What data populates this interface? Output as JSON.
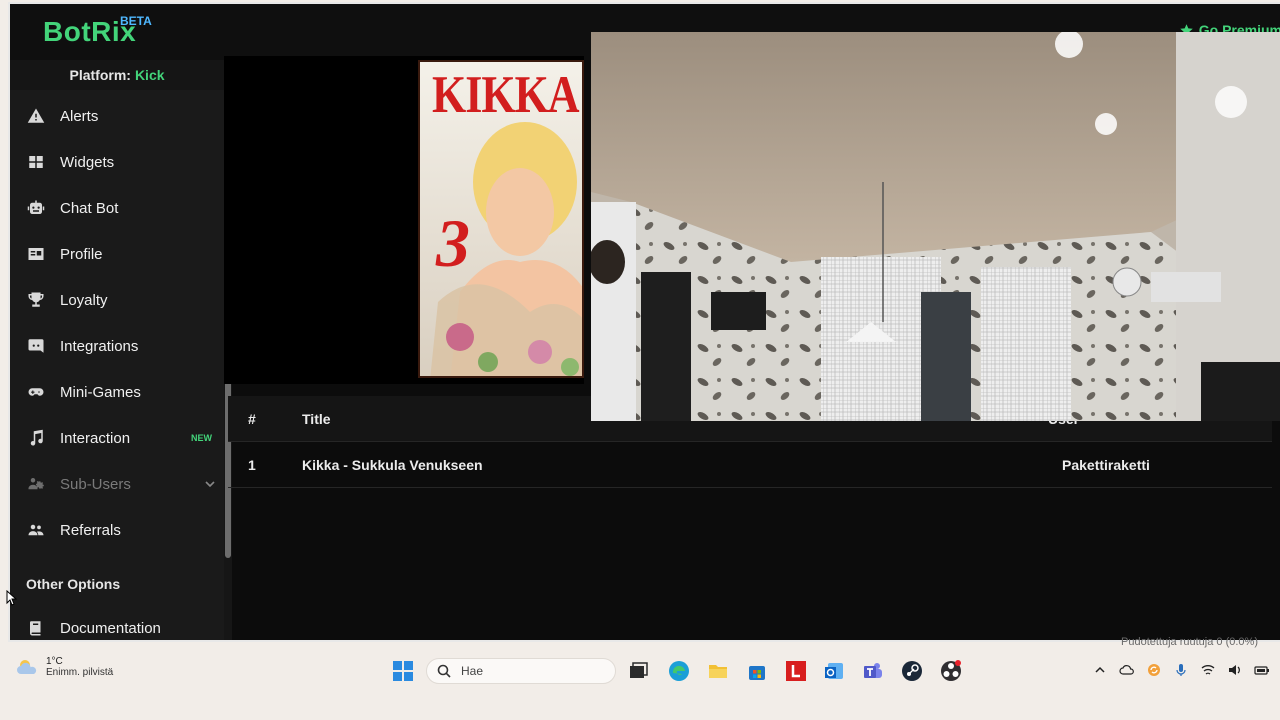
{
  "app": {
    "logo": "BotRix",
    "logo_badge": "BETA",
    "go_premium": "Go Premium"
  },
  "sidebar": {
    "platform_label": "Platform:",
    "platform_value": "Kick",
    "items": [
      {
        "label": "Alerts",
        "icon": "alert-triangle-icon"
      },
      {
        "label": "Widgets",
        "icon": "widgets-grid-icon"
      },
      {
        "label": "Chat Bot",
        "icon": "robot-icon"
      },
      {
        "label": "Profile",
        "icon": "id-card-icon"
      },
      {
        "label": "Loyalty",
        "icon": "trophy-icon"
      },
      {
        "label": "Integrations",
        "icon": "discord-icon"
      },
      {
        "label": "Mini-Games",
        "icon": "gamepad-icon"
      },
      {
        "label": "Interaction",
        "icon": "music-note-icon",
        "badge": "NEW"
      },
      {
        "label": "Sub-Users",
        "icon": "users-cog-icon"
      },
      {
        "label": "Referrals",
        "icon": "user-friends-icon"
      }
    ],
    "section_title": "Other Options",
    "doc_item": {
      "label": "Documentation",
      "icon": "book-icon"
    }
  },
  "poster": {
    "title": "KIKKA",
    "number": "3"
  },
  "table": {
    "headers": [
      "#",
      "Title",
      "User"
    ],
    "rows": [
      {
        "num": "1",
        "title": "Kikka - Sukkula Venukseen",
        "user": "Pakettiraketti"
      }
    ]
  },
  "taskbar": {
    "weather_temp": "1°C",
    "weather_desc": "Enimm. pilvistä",
    "search_placeholder": "Hae",
    "status_strip": "Pudotettuja ruutuja 0 (0.0%)"
  },
  "colors": {
    "accent": "#43d47a",
    "beta": "#4fb8ff",
    "bg": "#0c0c0c",
    "sidebar": "#1a1a1a"
  }
}
